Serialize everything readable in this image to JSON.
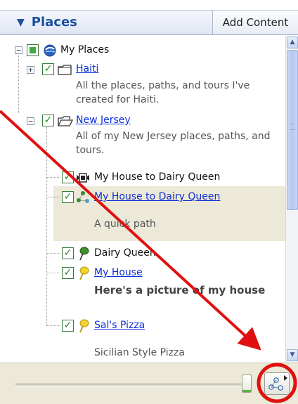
{
  "header": {
    "places_label": "Places",
    "add_content_label": "Add Content"
  },
  "tree": {
    "my_places": {
      "label": "My Places"
    },
    "haiti": {
      "label": "Haiti",
      "description": "All the places, paths, and tours I've created for Haiti."
    },
    "new_jersey": {
      "label": "New Jersey",
      "description": "All of my New Jersey places, paths, and tours."
    },
    "tour": {
      "label": "My House to Dairy Queen"
    },
    "path": {
      "label": "My House to Dairy Queen",
      "description": "A quick path"
    },
    "dairy_queen": {
      "label": "Dairy Queen"
    },
    "my_house": {
      "label": "My House",
      "description": "Here's a picture of my house"
    },
    "sals_pizza": {
      "label": "Sal's Pizza",
      "description": "Sicilian Style Pizza"
    }
  },
  "icons": {
    "earth": "earth-icon",
    "folder": "folder-icon",
    "folder_open": "folder-open-icon",
    "tour": "tour-camera-icon",
    "path": "path-icon",
    "pin_green": "placemark-green-icon",
    "pin_yellow": "placemark-yellow-icon"
  },
  "colors": {
    "accent": "#1d4f9e",
    "link": "#0b2fd6",
    "annotation": "#e01010",
    "selection": "#ece9d8"
  }
}
